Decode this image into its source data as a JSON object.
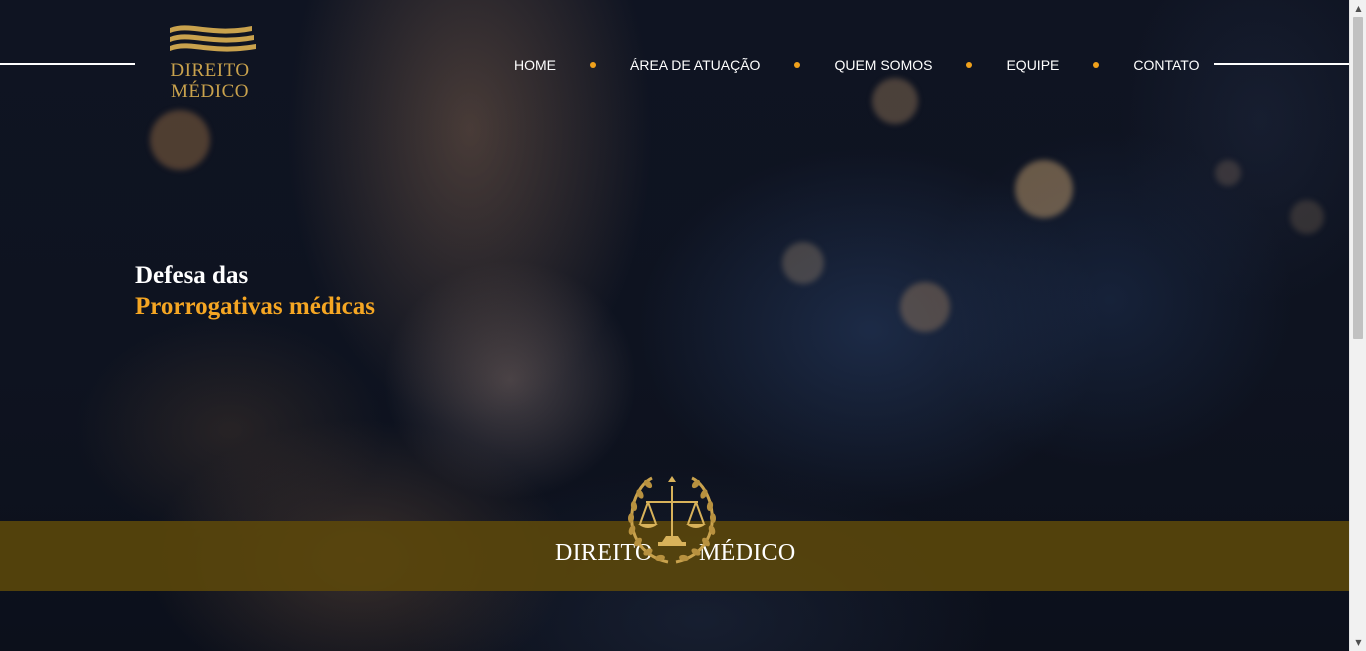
{
  "logo": {
    "line1": "DIREITO",
    "line2": "MÉDICO",
    "icon": "waves-logo-icon"
  },
  "nav": {
    "items": [
      {
        "label": "HOME"
      },
      {
        "label": "ÁREA DE ATUAÇÃO"
      },
      {
        "label": "QUEM SOMOS"
      },
      {
        "label": "EQUIPE"
      },
      {
        "label": "CONTATO"
      }
    ]
  },
  "hero": {
    "headline_line1": "Defesa das",
    "headline_line2": "Prorrogativas médicas"
  },
  "band": {
    "word_left": "DIREITO",
    "word_right": "MÉDICO",
    "emblem_icon": "scales-of-justice-icon"
  },
  "colors": {
    "accent": "#f5a623",
    "nav_dot": "#f0a11b",
    "logo_gold": "#c9a24d",
    "band": "#5c480a",
    "background": "#0d1220"
  }
}
